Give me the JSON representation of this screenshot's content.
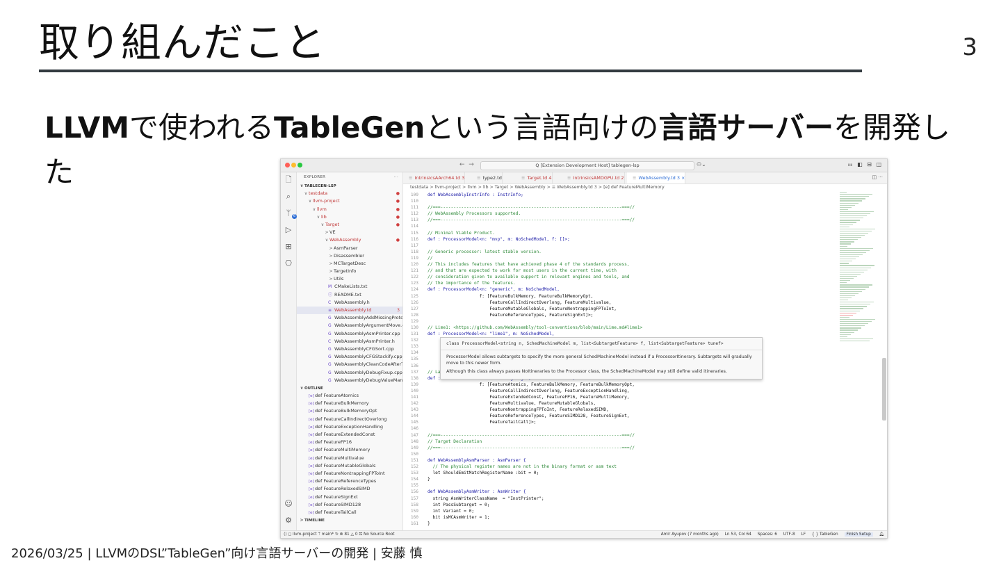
{
  "slide": {
    "title": "取り組んだこと",
    "page_number": "3",
    "subtitle_parts": [
      "LLVM",
      "で使われる",
      "TableGen",
      "という言語向けの",
      "言語サーバー",
      "を開発した"
    ],
    "footer": "2026/03/25 | LLVMのDSL”TableGen”向け言語サーバーの開発 | 安藤 慎"
  },
  "vscode": {
    "command_center": "Q [Extension Development Host] tablegen-lsp",
    "explorer_label": "EXPLORER",
    "explorer_more": "···",
    "root_folder": "TABLEGEN-LSP",
    "tree": [
      {
        "indent": 1,
        "chev": "∨",
        "label": "testdata",
        "red": true,
        "dot": "●"
      },
      {
        "indent": 2,
        "chev": "∨",
        "label": "llvm-project",
        "red": true,
        "dot": "●"
      },
      {
        "indent": 3,
        "chev": "∨",
        "label": "llvm",
        "red": true,
        "dot": "●"
      },
      {
        "indent": 4,
        "chev": "∨",
        "label": "lib",
        "red": true,
        "dot": "●"
      },
      {
        "indent": 5,
        "chev": "∨",
        "label": "Target",
        "red": true,
        "dot": "●"
      },
      {
        "indent": 6,
        "chev": ">",
        "label": "VE"
      },
      {
        "indent": 6,
        "chev": "∨",
        "label": "WebAssembly",
        "red": true,
        "dot": "●"
      },
      {
        "indent": 7,
        "chev": ">",
        "label": "AsmParser"
      },
      {
        "indent": 7,
        "chev": ">",
        "label": "Disassembler"
      },
      {
        "indent": 7,
        "chev": ">",
        "label": "MCTargetDesc"
      },
      {
        "indent": 7,
        "chev": ">",
        "label": "TargetInfo"
      },
      {
        "indent": 7,
        "chev": ">",
        "label": "Utils"
      },
      {
        "indent": 7,
        "icon": "M",
        "label": "CMakeLists.txt"
      },
      {
        "indent": 7,
        "icon": "ⓘ",
        "label": "README.txt"
      },
      {
        "indent": 7,
        "icon": "C",
        "label": "WebAssembly.h"
      },
      {
        "indent": 7,
        "icon": "",
        "label": "WebAssembly.td",
        "red": true,
        "dot": "3",
        "selected": true
      },
      {
        "indent": 7,
        "icon": "G",
        "label": "WebAssemblyAddMissingPrototy..."
      },
      {
        "indent": 7,
        "icon": "G",
        "label": "WebAssemblyArgumentMove.cpp"
      },
      {
        "indent": 7,
        "icon": "G",
        "label": "WebAssemblyAsmPrinter.cpp"
      },
      {
        "indent": 7,
        "icon": "C",
        "label": "WebAssemblyAsmPrinter.h"
      },
      {
        "indent": 7,
        "icon": "G",
        "label": "WebAssemblyCFGSort.cpp"
      },
      {
        "indent": 7,
        "icon": "G",
        "label": "WebAssemblyCFGStackify.cpp"
      },
      {
        "indent": 7,
        "icon": "G",
        "label": "WebAssemblyCleanCodeAfterTra..."
      },
      {
        "indent": 7,
        "icon": "G",
        "label": "WebAssemblyDebugFixup.cpp"
      },
      {
        "indent": 7,
        "icon": "G",
        "label": "WebAssemblyDebugValueManag..."
      }
    ],
    "outline_label": "OUTLINE",
    "outline": [
      "def FeatureAtomics",
      "def FeatureBulkMemory",
      "def FeatureBulkMemoryOpt",
      "def FeatureCallIndirectOverlong",
      "def FeatureExceptionHandling",
      "def FeatureExtendedConst",
      "def FeatureFP16",
      "def FeatureMultiMemory",
      "def FeatureMultivalue",
      "def FeatureMutableGlobals",
      "def FeatureNontrappingFPToInt",
      "def FeatureReferenceTypes",
      "def FeatureRelaxedSIMD",
      "def FeatureSignExt",
      "def FeatureSIMD128",
      "def FeatureTailCall"
    ],
    "timeline_label": "TIMELINE",
    "tabs": [
      {
        "label": "IntrinsicsAArch64.td 3",
        "red": true
      },
      {
        "label": "type2.td",
        "red": false
      },
      {
        "label": "Target.td 4",
        "red": true
      },
      {
        "label": "IntrinsicsAMDGPU.td 2",
        "red": true
      },
      {
        "label": "WebAssembly.td 3  ×",
        "active": true
      }
    ],
    "breadcrumb": "testdata > llvm-project > llvm > lib > Target > WebAssembly > ≡ WebAssembly.td 3 > [e] def FeatureMultiMemory",
    "code": [
      [
        "109",
        "def WebAssemblyInstrInfo : InstrInfo;",
        "def"
      ],
      [
        "110",
        "",
        ""
      ],
      [
        "111",
        "//===----------------------------------------------------------------------===//",
        "com"
      ],
      [
        "112",
        "// WebAssembly Processors supported.",
        "com"
      ],
      [
        "113",
        "//===----------------------------------------------------------------------===//",
        "com"
      ],
      [
        "114",
        "",
        ""
      ],
      [
        "115",
        "// Minimal Viable Product.",
        "com"
      ],
      [
        "116",
        "def : ProcessorModel<n: \"mvp\", m: NoSchedModel, f: []>;",
        "def"
      ],
      [
        "117",
        "",
        ""
      ],
      [
        "118",
        "// Generic processor: latest stable version.",
        "com"
      ],
      [
        "119",
        "//",
        "com"
      ],
      [
        "120",
        "// This includes features that have achieved phase 4 of the standards process,",
        "com"
      ],
      [
        "121",
        "// and that are expected to work for most users in the current time, with",
        "com"
      ],
      [
        "122",
        "// consideration given to available support in relevant engines and tools, and",
        "com"
      ],
      [
        "123",
        "// the importance of the features.",
        "com"
      ],
      [
        "124",
        "def : ProcessorModel<n: \"generic\", m: NoSchedModel,",
        "def"
      ],
      [
        "125",
        "                    f: [FeatureBulkMemory, FeatureBulkMemoryOpt,",
        "id"
      ],
      [
        "126",
        "                        FeatureCallIndirectOverlong, FeatureMultivalue,",
        "id"
      ],
      [
        "127",
        "                        FeatureMutableGlobals, FeatureNontrappingFPToInt,",
        "id"
      ],
      [
        "128",
        "                        FeatureReferenceTypes, FeatureSignExt]>;",
        "id"
      ],
      [
        "129",
        "",
        ""
      ],
      [
        "130",
        "// Lime1: <https://github.com/WebAssembly/tool-conventions/blob/main/Lime.md#lime1>",
        "com"
      ],
      [
        "131",
        "def : ProcessorModel<n: \"lime1\", m: NoSchedModel,",
        "def"
      ],
      [
        "132",
        "",
        ""
      ],
      [
        "133",
        "",
        ""
      ],
      [
        "134",
        "",
        ""
      ],
      [
        "135",
        "",
        ""
      ],
      [
        "136",
        "",
        ""
      ],
      [
        "137",
        "// Lat",
        "com"
      ],
      [
        "138",
        "def : ProcessorModel<n: \"bleeding-edge\", m: NoSchedModel,",
        "def"
      ],
      [
        "139",
        "                    f: [FeatureAtomics, FeatureBulkMemory, FeatureBulkMemoryOpt,",
        "id"
      ],
      [
        "140",
        "                        FeatureCallIndirectOverlong, FeatureExceptionHandling,",
        "id"
      ],
      [
        "141",
        "                        FeatureExtendedConst, FeatureFP16, FeatureMultiMemory,",
        "id"
      ],
      [
        "142",
        "                        FeatureMultivalue, FeatureMutableGlobals,",
        "id"
      ],
      [
        "143",
        "                        FeatureNontrappingFPToInt, FeatureRelaxedSIMD,",
        "id"
      ],
      [
        "144",
        "                        FeatureReferenceTypes, FeatureSIMD128, FeatureSignExt,",
        "id"
      ],
      [
        "145",
        "                        FeatureTailCall]>;",
        "id"
      ],
      [
        "146",
        "",
        ""
      ],
      [
        "147",
        "//===----------------------------------------------------------------------===//",
        "com"
      ],
      [
        "148",
        "// Target Declaration",
        "com"
      ],
      [
        "149",
        "//===----------------------------------------------------------------------===//",
        "com"
      ],
      [
        "150",
        "",
        ""
      ],
      [
        "151",
        "def WebAssemblyAsmParser : AsmParser {",
        "def"
      ],
      [
        "152",
        "  // The physical register names are not in the binary format or asm text",
        "com"
      ],
      [
        "153",
        "  let ShouldEmitMatchRegisterName :bit = 0;",
        "id"
      ],
      [
        "154",
        "}",
        "id"
      ],
      [
        "155",
        "",
        ""
      ],
      [
        "156",
        "def WebAssemblyAsmWriter : AsmWriter {",
        "def"
      ],
      [
        "157",
        "  string AsmWriterClassName  = \"InstPrinter\";",
        "id"
      ],
      [
        "158",
        "  int PassSubtarget = 0;",
        "id"
      ],
      [
        "159",
        "  int Variant = 0;",
        "id"
      ],
      [
        "160",
        "  bit isMCAsmWriter = 1;",
        "id"
      ],
      [
        "161",
        "}",
        "id"
      ]
    ],
    "hover": {
      "signature": "class ProcessorModel<string n, SchedMachineModel m, list<SubtargetFeature> f, list<SubtargetFeature> tunef>",
      "para1": "ProcessorModel allows subtargets to specify the more general SchedMachineModel instead if a ProcessorItinerary. Subtargets will gradually move to this newer form.",
      "para2": "Although this class always passes NoItineraries to the Processor class, the SchedMachineModel may still define valid itineraries."
    },
    "status": {
      "left": "⟨⟩  ◻ llvm-project  ᛘ main*  ↻   ⊗ 81 △ 0   ⛞ No Source Root",
      "blame": "Amir Ayupov (7 months ago)",
      "position": "Ln 53, Col 64",
      "spaces": "Spaces: 6",
      "encoding": "UTF-8",
      "eol": "LF",
      "language": "{ } TableGen",
      "finish": "Finish Setup"
    }
  }
}
